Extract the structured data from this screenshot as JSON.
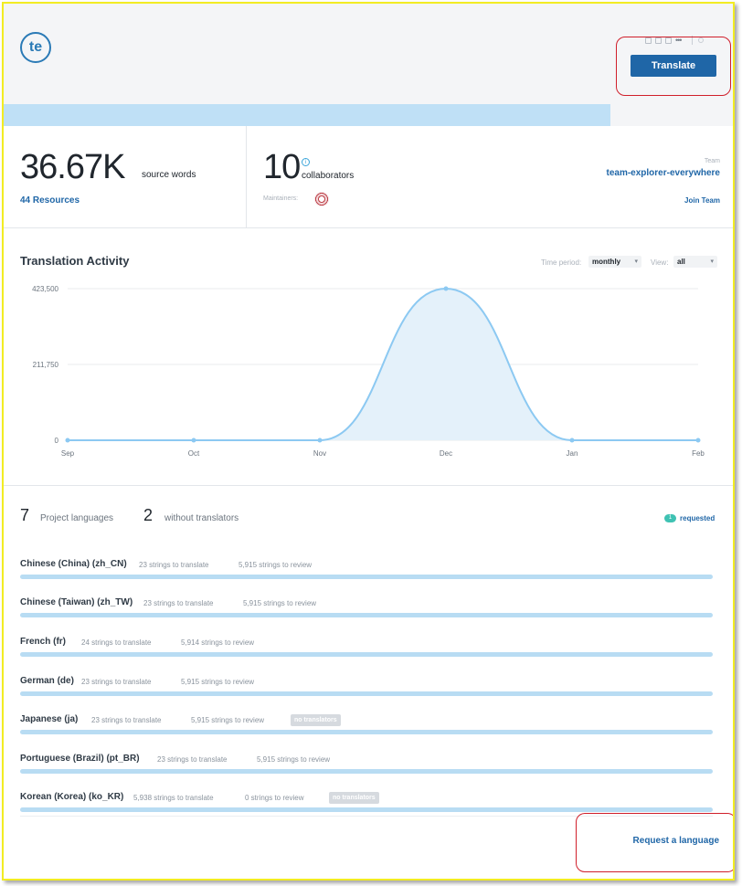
{
  "header": {
    "logo_text": "te",
    "translate_label": "Translate",
    "toolbar_icons": [
      "square-icon",
      "square-icon",
      "square-icon",
      "more-icon"
    ],
    "more_glyph": "•••"
  },
  "progress": {
    "translated_fraction": 0.832
  },
  "stats": {
    "source_words_value": "36.67K",
    "source_words_label": "source words",
    "resources_link": "44 Resources",
    "collaborators_value": "10",
    "collaborators_label": "collaborators",
    "info_glyph": "i",
    "maintainers_label": "Maintainers:",
    "team_label": "Team",
    "team_name": "team-explorer-everywhere",
    "join_team_label": "Join Team"
  },
  "activity": {
    "title": "Translation Activity",
    "time_period_label": "Time period:",
    "time_period_value": "monthly",
    "view_label": "View:",
    "view_value": "all"
  },
  "chart_data": {
    "type": "area",
    "title": "Translation Activity",
    "categories": [
      "Sep",
      "Oct",
      "Nov",
      "Dec",
      "Jan",
      "Feb"
    ],
    "series": [
      {
        "values": [
          0,
          0,
          0,
          423500,
          0,
          0
        ]
      }
    ],
    "y_ticks": [
      "0",
      "211,750",
      "423,500"
    ],
    "ylim": [
      0,
      423500
    ],
    "grid": true,
    "colors": {
      "line": "#8cc9f2",
      "fill": "#e4f1fa",
      "grid": "#e8ebee"
    }
  },
  "languages": {
    "project_languages_count": "7",
    "project_languages_label": "Project languages",
    "without_translators_count": "2",
    "without_translators_label": "without translators",
    "requested_count": "1",
    "requested_label": "requested",
    "items": [
      {
        "name": "Chinese (China) (zh_CN)",
        "to_translate": "23 strings to translate",
        "to_review": "5,915 strings to review",
        "no_translators": ""
      },
      {
        "name": "Chinese (Taiwan) (zh_TW)",
        "to_translate": "23 strings to translate",
        "to_review": "5,915 strings to review",
        "no_translators": ""
      },
      {
        "name": "French (fr)",
        "to_translate": "24 strings to translate",
        "to_review": "5,914 strings to review",
        "no_translators": ""
      },
      {
        "name": "German (de)",
        "to_translate": "23 strings to translate",
        "to_review": "5,915 strings to review",
        "no_translators": ""
      },
      {
        "name": "Japanese (ja)",
        "to_translate": "23 strings to translate",
        "to_review": "5,915 strings to review",
        "no_translators": "no translators"
      },
      {
        "name": "Portuguese (Brazil) (pt_BR)",
        "to_translate": "23 strings to translate",
        "to_review": "5,915 strings to review",
        "no_translators": ""
      },
      {
        "name": "Korean (Korea) (ko_KR)",
        "to_translate": "5,938 strings to translate",
        "to_review": "0 strings to review",
        "no_translators": "no translators"
      }
    ],
    "request_link": "Request a language"
  },
  "colors": {
    "accent": "#1f66a7",
    "highlight": "#d01f2b",
    "frame": "#f2ec23",
    "progress_fill": "#bfe0f6",
    "language_bar": "#b8dcf3"
  }
}
